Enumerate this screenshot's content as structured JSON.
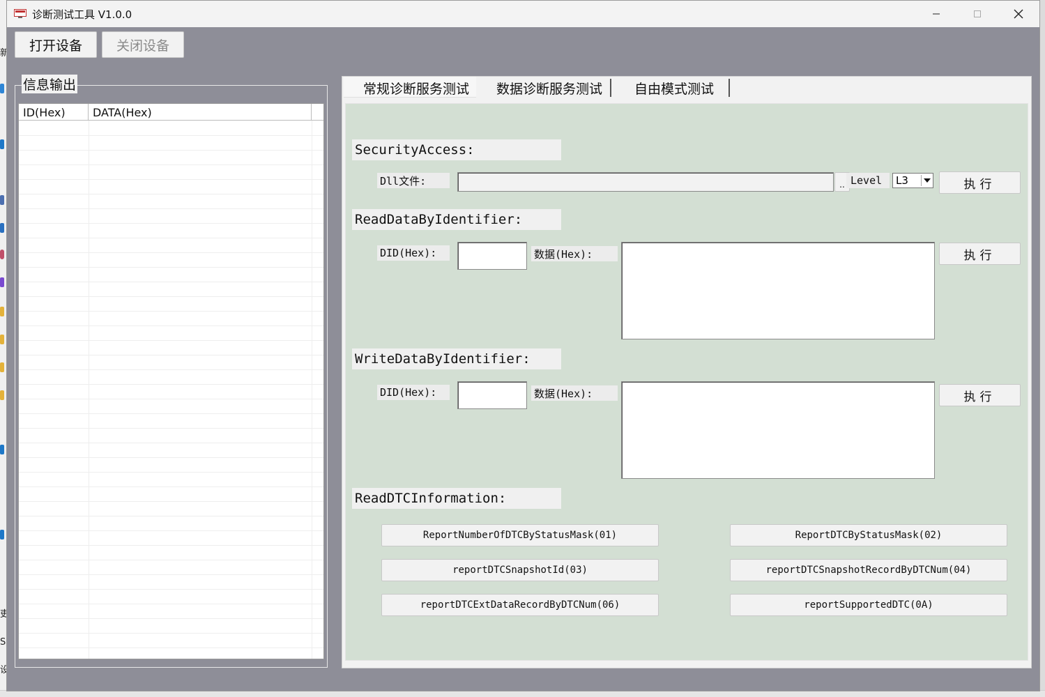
{
  "window": {
    "title": "诊断测试工具 V1.0.0"
  },
  "toolbar": {
    "open_device": "打开设备",
    "close_device": "关闭设备"
  },
  "info_output": {
    "title": "信息输出",
    "columns": [
      "ID(Hex)",
      "DATA(Hex)"
    ]
  },
  "tabs": [
    {
      "label": "常规诊断服务测试"
    },
    {
      "label": "数据诊断服务测试"
    },
    {
      "label": "自由模式测试"
    }
  ],
  "security_access": {
    "title": "SecurityAccess:",
    "dll_label": "Dll文件:",
    "dll_value": "",
    "browse_label": "..",
    "level_label": "Level",
    "level_value": "L3",
    "execute": "执行"
  },
  "read_did": {
    "title": "ReadDataByIdentifier:",
    "did_label": "DID(Hex):",
    "did_value": "",
    "data_label": "数据(Hex):",
    "data_value": "",
    "execute": "执行"
  },
  "write_did": {
    "title": "WriteDataByIdentifier:",
    "did_label": "DID(Hex):",
    "did_value": "",
    "data_label": "数据(Hex):",
    "data_value": "",
    "execute": "执行"
  },
  "read_dtc": {
    "title": "ReadDTCInformation:",
    "buttons": [
      "ReportNumberOfDTCByStatusMask(01)",
      "ReportDTCByStatusMask(02)",
      "reportDTCSnapshotId(03)",
      "reportDTCSnapshotRecordByDTCNum(04)",
      "reportDTCExtDataRecordByDTCNum(06)",
      "reportSupportedDTC(0A)"
    ]
  },
  "desktop_fragments": [
    "新",
    "吏",
    "S",
    "设"
  ]
}
